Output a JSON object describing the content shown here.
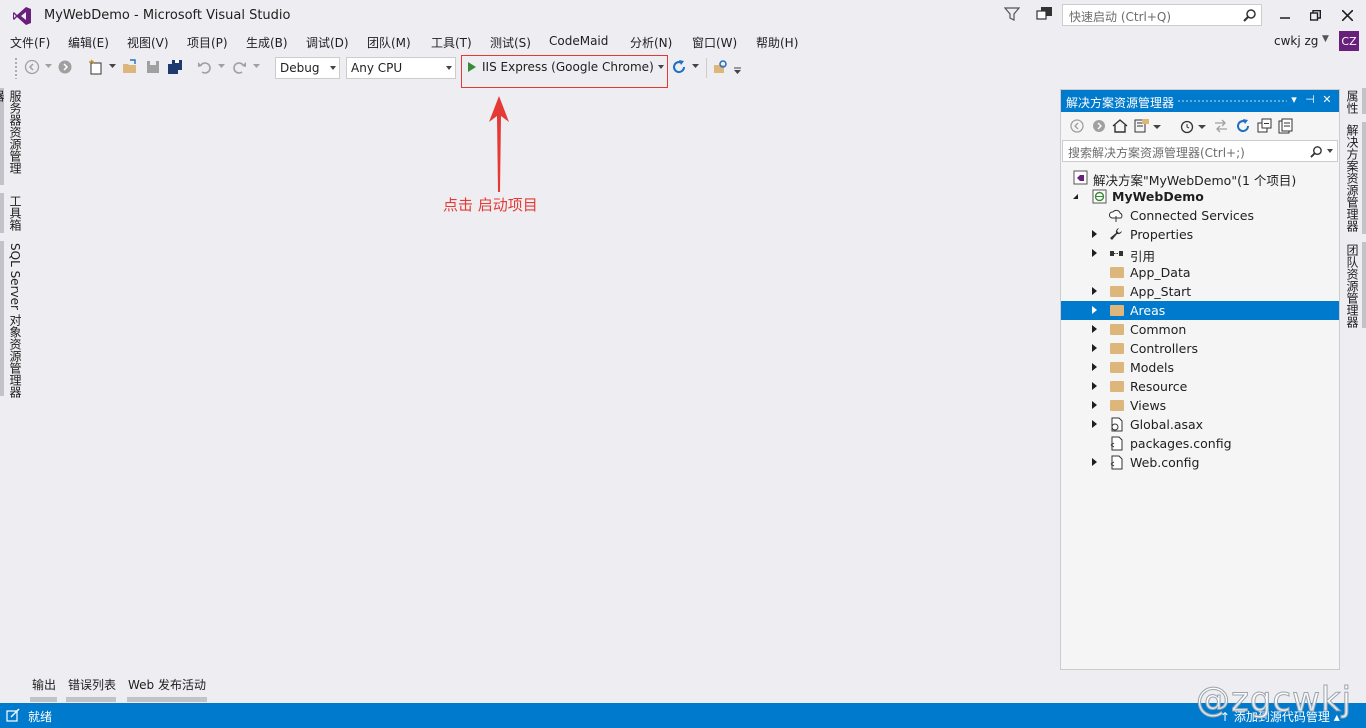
{
  "window": {
    "title": "MyWebDemo - Microsoft Visual Studio",
    "quick_launch_placeholder": "快速启动 (Ctrl+Q)",
    "user_name": "cwkj zg",
    "avatar_initials": "CZ"
  },
  "menu": [
    {
      "label": "文件(F)"
    },
    {
      "label": "编辑(E)"
    },
    {
      "label": "视图(V)"
    },
    {
      "label": "项目(P)"
    },
    {
      "label": "生成(B)"
    },
    {
      "label": "调试(D)"
    },
    {
      "label": "团队(M)"
    },
    {
      "label": "工具(T)"
    },
    {
      "label": "测试(S)"
    },
    {
      "label": "CodeMaid"
    },
    {
      "label": "分析(N)"
    },
    {
      "label": "窗口(W)"
    },
    {
      "label": "帮助(H)"
    }
  ],
  "toolbar": {
    "configuration": "Debug",
    "platform": "Any CPU",
    "run_target": "IIS Express (Google Chrome)"
  },
  "annotation": {
    "text": "点击 启动项目",
    "color": "#e53935"
  },
  "left_tabs": [
    {
      "label": "服务器资源管理器"
    },
    {
      "label": "工具箱"
    },
    {
      "label": "SQL Server 对象资源管理器"
    }
  ],
  "right_tabs": [
    {
      "label": "属性"
    },
    {
      "label": "解决方案资源管理器"
    },
    {
      "label": "团队资源管理器"
    }
  ],
  "solution_explorer": {
    "title": "解决方案资源管理器",
    "search_placeholder": "搜索解决方案资源管理器(Ctrl+;)",
    "solution_label": "解决方案\"MyWebDemo\"(1 个项目)",
    "project_label": "MyWebDemo",
    "items": [
      {
        "label": "Connected Services",
        "icon": "connected-services-icon",
        "expandable": false
      },
      {
        "label": "Properties",
        "icon": "wrench-icon",
        "expandable": true
      },
      {
        "label": "引用",
        "icon": "references-icon",
        "expandable": true
      },
      {
        "label": "App_Data",
        "icon": "folder-icon",
        "expandable": false
      },
      {
        "label": "App_Start",
        "icon": "folder-icon",
        "expandable": true
      },
      {
        "label": "Areas",
        "icon": "folder-icon",
        "expandable": true,
        "selected": true
      },
      {
        "label": "Common",
        "icon": "folder-icon",
        "expandable": true
      },
      {
        "label": "Controllers",
        "icon": "folder-icon",
        "expandable": true
      },
      {
        "label": "Models",
        "icon": "folder-icon",
        "expandable": true
      },
      {
        "label": "Resource",
        "icon": "folder-icon",
        "expandable": true
      },
      {
        "label": "Views",
        "icon": "folder-icon",
        "expandable": true
      },
      {
        "label": "Global.asax",
        "icon": "file-icon",
        "expandable": true
      },
      {
        "label": "packages.config",
        "icon": "config-file-icon",
        "expandable": false
      },
      {
        "label": "Web.config",
        "icon": "config-file-icon",
        "expandable": true
      }
    ]
  },
  "bottom_tabs": [
    {
      "label": "输出"
    },
    {
      "label": "错误列表"
    },
    {
      "label": "Web 发布活动"
    }
  ],
  "status": {
    "text": "就绪",
    "right_text": "添加到源代码管理",
    "accent": "#007acc"
  },
  "watermark": "@zgcwkj"
}
